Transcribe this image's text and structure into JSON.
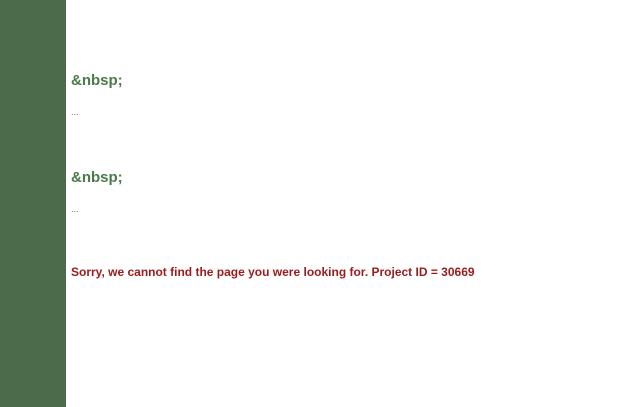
{
  "sections": [
    {
      "heading": "&nbsp;",
      "snippet": "..."
    },
    {
      "heading": "&nbsp;",
      "snippet": "..."
    }
  ],
  "error": {
    "message": "Sorry, we cannot find the page you were looking for. Project ID = 30669"
  },
  "colors": {
    "sidebar": "#4b6b4b",
    "heading": "#4b7a4b",
    "error": "#9b1b1b"
  }
}
